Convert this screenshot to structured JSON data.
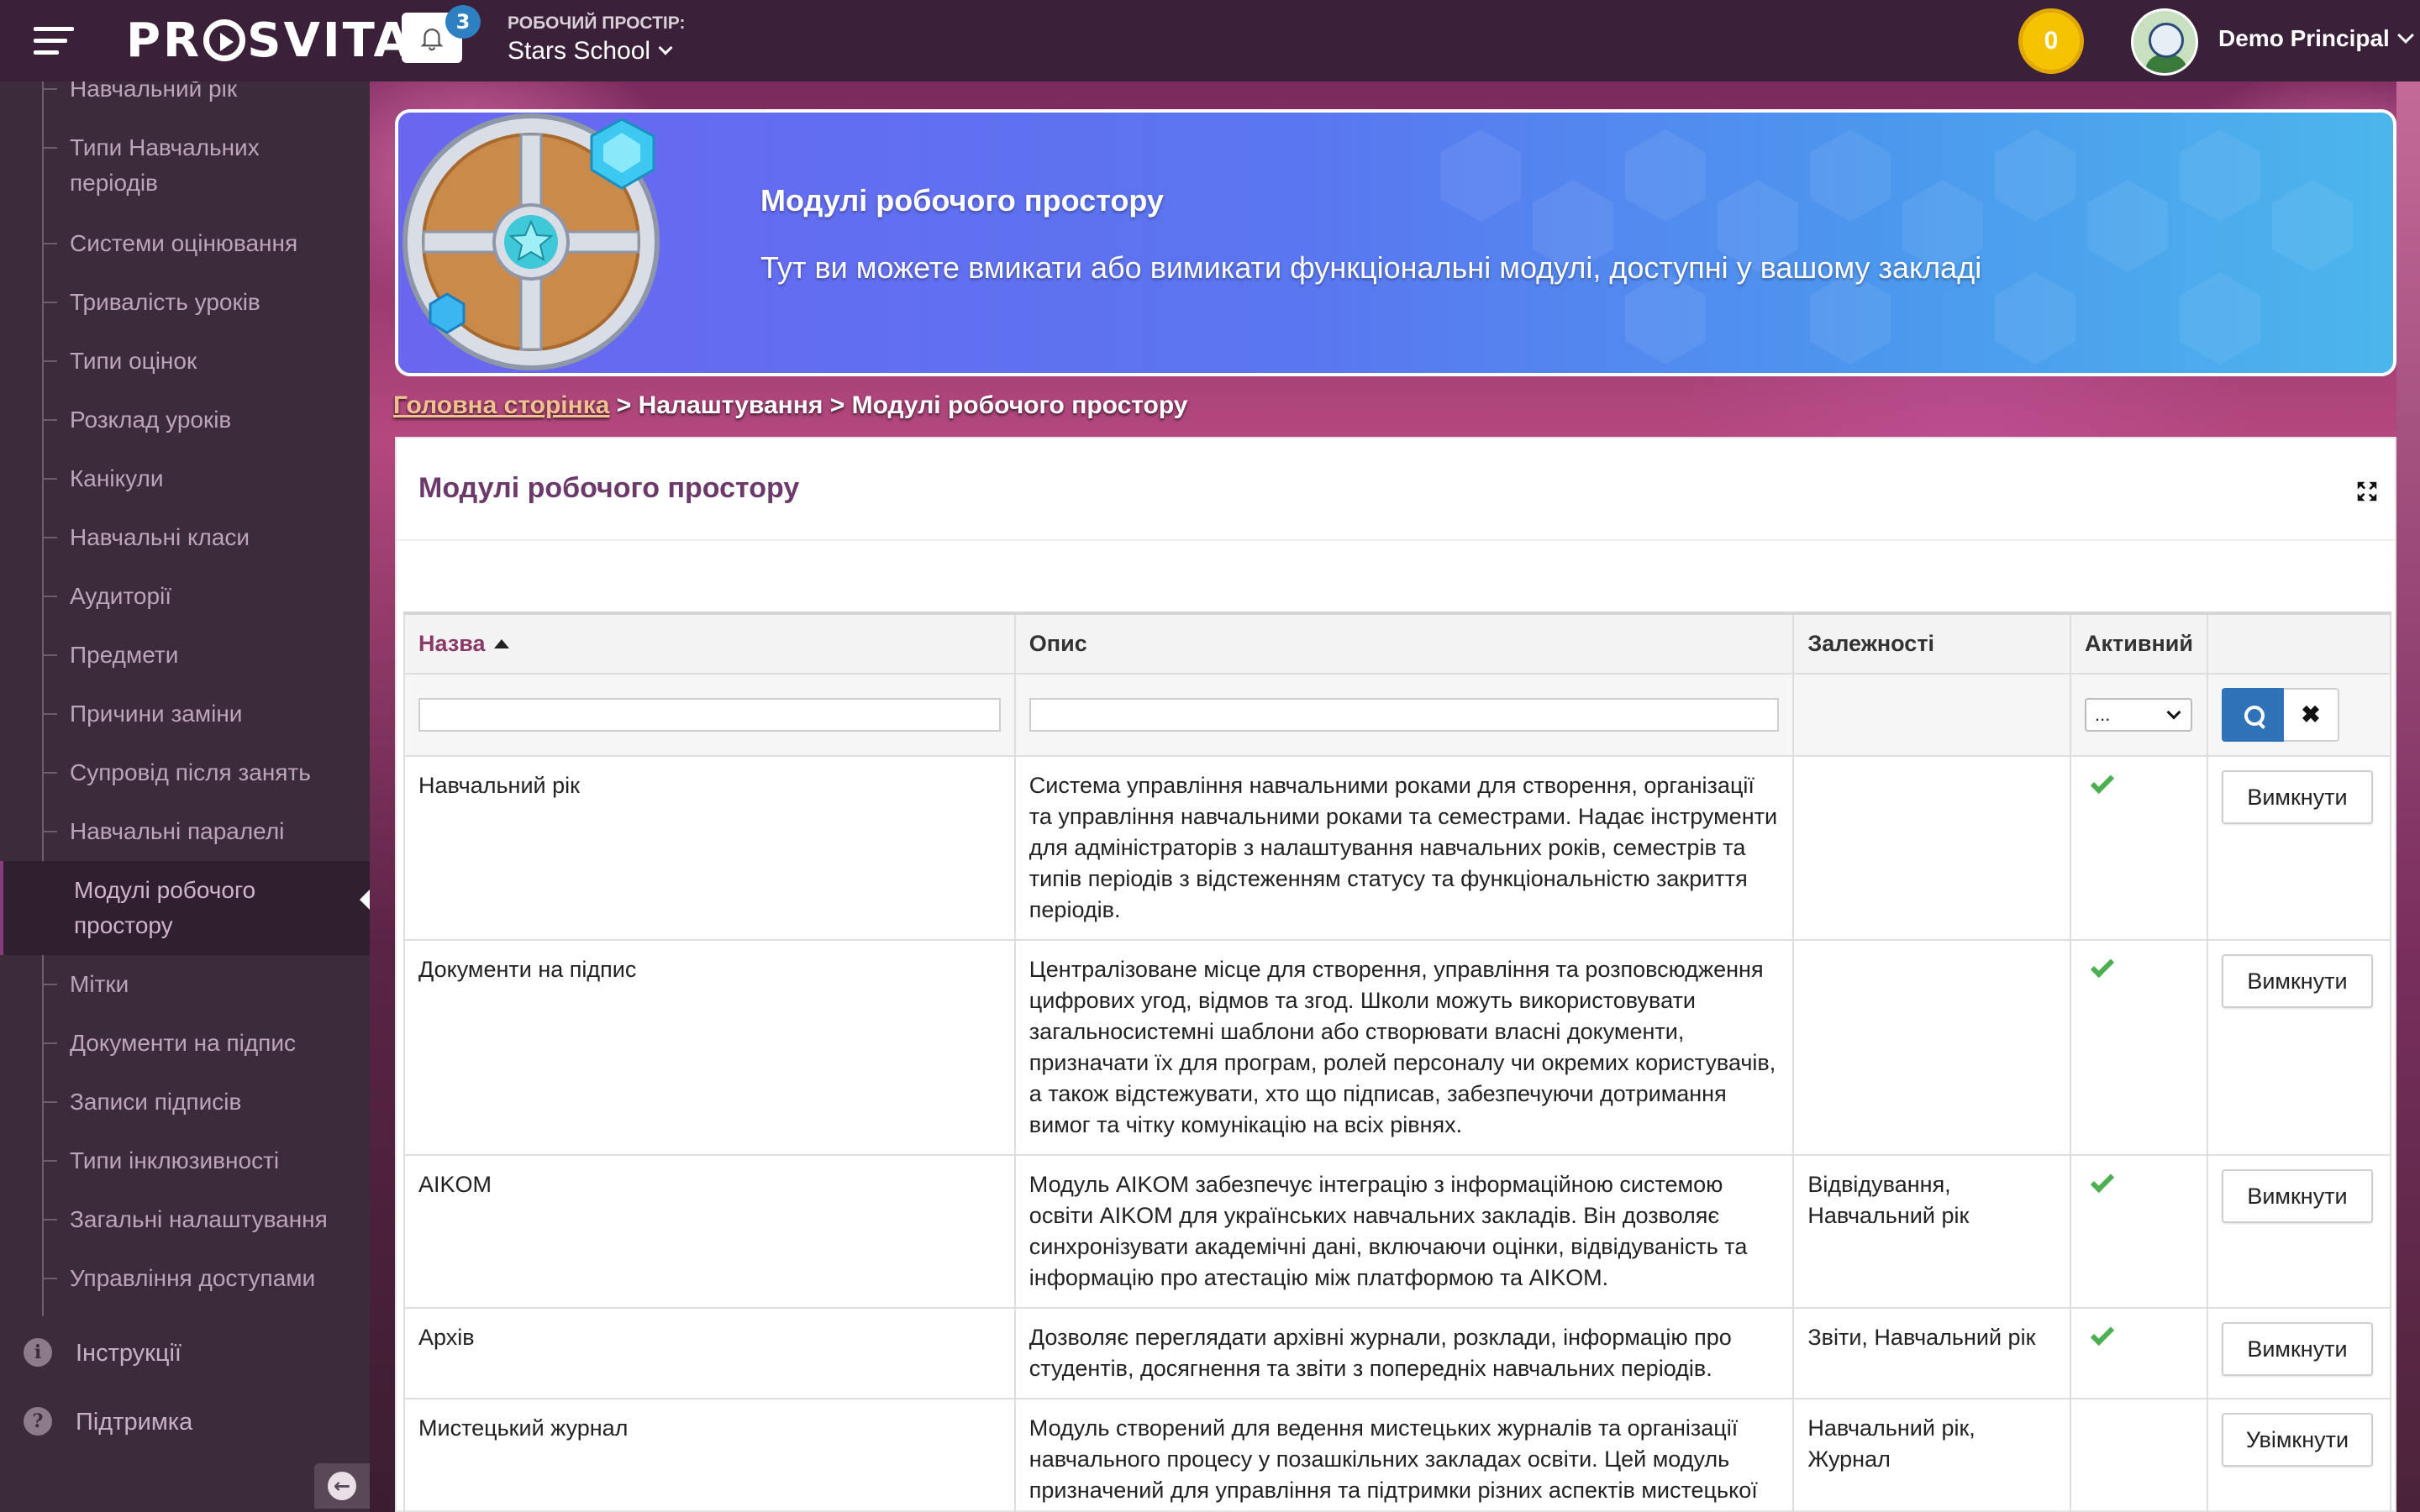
{
  "topbar": {
    "logo": "PR SVITA",
    "notifications_count": "3",
    "workspace_label": "РОБОЧИЙ ПРОСТІР:",
    "workspace_name": "Stars School",
    "coins": "0",
    "user_name": "Demo Principal"
  },
  "sidebar": {
    "items": [
      {
        "label": "Навчальний рік"
      },
      {
        "label": "Типи Навчальних періодів"
      },
      {
        "label": "Системи оцінювання"
      },
      {
        "label": "Тривалість уроків"
      },
      {
        "label": "Типи оцінок"
      },
      {
        "label": "Розклад уроків"
      },
      {
        "label": "Канікули"
      },
      {
        "label": "Навчальні класи"
      },
      {
        "label": "Аудиторії"
      },
      {
        "label": "Предмети"
      },
      {
        "label": "Причини заміни"
      },
      {
        "label": "Супровід після занять"
      },
      {
        "label": "Навчальні паралелі"
      },
      {
        "label": "Модулі робочого простору"
      },
      {
        "label": "Мітки"
      },
      {
        "label": "Документи на підпис"
      },
      {
        "label": "Записи підписів"
      },
      {
        "label": "Типи інклюзивності"
      },
      {
        "label": "Загальні налаштування"
      },
      {
        "label": "Управління доступами"
      }
    ],
    "active_item": "Модулі робочого простору",
    "bottom": [
      {
        "label": "Інструкції",
        "icon": "info-icon"
      },
      {
        "label": "Підтримка",
        "icon": "help-icon"
      }
    ]
  },
  "banner": {
    "title": "Модулі робочого простору",
    "subtitle": "Тут ви можете вмикати або вимикати функціональні модулі, доступні у вашому закладі"
  },
  "breadcrumb": {
    "home": "Головна сторінка",
    "separator": ">",
    "settings": "Налаштування",
    "current": "Модулі робочого простору"
  },
  "panel": {
    "title": "Модулі робочого простору"
  },
  "table": {
    "columns": {
      "name": "Назва",
      "description": "Опис",
      "dependencies": "Залежності",
      "active": "Активний"
    },
    "filter": {
      "active_select": "..."
    },
    "rows": [
      {
        "name": "Навчальний рік",
        "description": "Система управління навчальними роками для створення, організації та управління навчальними роками та семестрами. Надає інструменти для адміністраторів з налаштування навчальних років, семестрів та типів періодів з відстеженням статусу та функціональністю закриття періодів.",
        "dependencies": "",
        "active": true,
        "action": "Вимкнути"
      },
      {
        "name": "Документи на підпис",
        "description": "Централізоване місце для створення, управління та розповсюдження цифрових угод, відмов та згод. Школи можуть використовувати загальносистемні шаблони або створювати власні документи, призначати їх для програм, ролей персоналу чи окремих користувачів, а також відстежувати, хто що підписав, забезпечуючи дотримання вимог та чітку комунікацію на всіх рівнях.",
        "dependencies": "",
        "active": true,
        "action": "Вимкнути"
      },
      {
        "name": "AIKOM",
        "description": "Модуль AIKOM забезпечує інтеграцію з інформаційною системою освіти AIKOM для українських навчальних закладів. Він дозволяє синхронізувати академічні дані, включаючи оцінки, відвідуваність та інформацію про атестацію між платформою та AIKOM.",
        "dependencies": "Відвідування, Навчальний рік",
        "active": true,
        "action": "Вимкнути"
      },
      {
        "name": "Архів",
        "description": "Дозволяє переглядати архівні журнали, розклади, інформацію про студентів, досягнення та звіти з попередніх навчальних періодів.",
        "dependencies": "Звіти, Навчальний рік",
        "active": true,
        "action": "Вимкнути"
      },
      {
        "name": "Мистецький журнал",
        "description": "Модуль створений для ведення мистецьких журналів та організації навчального процесу у позашкільних закладах освіти. Цей модуль призначений для управління та підтримки різних аспектів мистецької",
        "dependencies": "Навчальний рік, Журнал",
        "active": false,
        "action": "Увімкнути"
      }
    ]
  },
  "colors": {
    "topbar": "#3a2038",
    "sidebar": "#3c2b3b",
    "accent": "#8a3a68",
    "search_button": "#2f72b8",
    "active_check": "#4caf50",
    "coin": "#f5c400"
  }
}
